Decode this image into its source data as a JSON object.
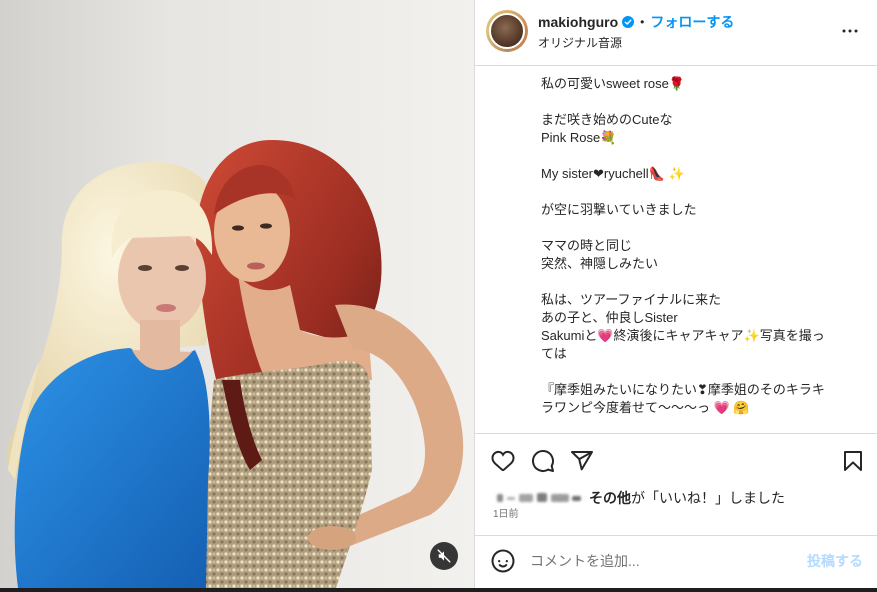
{
  "header": {
    "username": "makiohguro",
    "separator": "•",
    "follow_label": "フォローする",
    "audio_label": "オリジナル音源"
  },
  "caption": {
    "paragraphs": [
      [
        "私の可愛いsweet rose🌹"
      ],
      [
        "まだ咲き始めのCuteな",
        "Pink Rose💐"
      ],
      [
        "My sister❤ryuchell👠 ✨"
      ],
      [
        "が空に羽撃いていきました"
      ],
      [
        "ママの時と同じ",
        "突然、神隠しみたい"
      ],
      [
        "私は、ツアーファイナルに来た",
        "あの子と、仲良しSister",
        "Sakumiと💗終演後にキャアキャア✨写真を撮っ",
        "ては"
      ],
      [
        "『摩季姐みたいになりたい❣摩季姐のそのキラキ",
        "ラワンピ今度着せて～～～っ 💗 🤗"
      ]
    ]
  },
  "likes": {
    "others_label": "その他",
    "suffix": "が「いいね！」しました"
  },
  "timestamp": "1日前",
  "comment": {
    "placeholder": "コメントを追加...",
    "post_label": "投稿する"
  },
  "icons": {
    "verified": "verified-badge-icon",
    "more": "more-horizontal-icon",
    "like": "heart-icon",
    "comment": "comment-icon",
    "share": "share-icon",
    "save": "bookmark-icon",
    "emoji": "emoji-icon",
    "mute": "speaker-muted-icon"
  },
  "colors": {
    "text": "#262626",
    "accent": "#0095f6",
    "muted": "#737373",
    "divider": "#dbdbdb",
    "post_disabled": "#b3dbff"
  }
}
